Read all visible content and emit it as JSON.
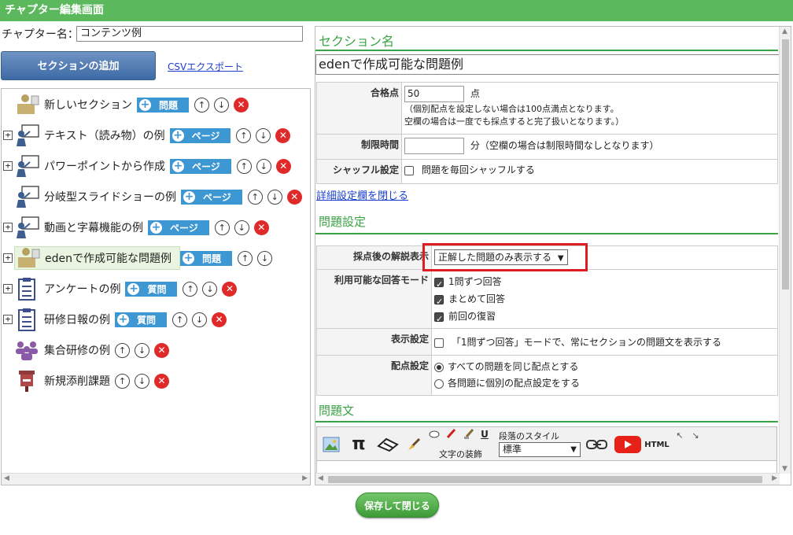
{
  "window": {
    "title": "チャプター編集画面"
  },
  "chapter": {
    "label": "チャプター名：",
    "value": "コンテンツ例"
  },
  "toolbar": {
    "add_section": "セクションの追加",
    "csv_export": "CSVエクスポート"
  },
  "tree": {
    "items": [
      {
        "label": "新しいセクション",
        "tag": "問題",
        "expandable": false,
        "icon": "teacher-podium-icon",
        "deletable": true
      },
      {
        "label": "テキスト（読み物）の例",
        "tag": "ページ",
        "expandable": true,
        "icon": "presenter-board-icon",
        "deletable": true
      },
      {
        "label": "パワーポイントから作成",
        "tag": "ページ",
        "expandable": true,
        "icon": "presenter-board-icon",
        "deletable": true
      },
      {
        "label": "分岐型スライドショーの例",
        "tag": "ページ",
        "expandable": false,
        "icon": "presenter-board-icon",
        "deletable": true
      },
      {
        "label": "動画と字幕機能の例",
        "tag": "ページ",
        "expandable": true,
        "icon": "presenter-board-icon",
        "deletable": true
      },
      {
        "label": "edenで作成可能な問題例",
        "tag": "問題",
        "expandable": true,
        "icon": "teacher-podium-icon",
        "deletable": false,
        "selected": true
      },
      {
        "label": "アンケートの例",
        "tag": "質問",
        "expandable": true,
        "icon": "clipboard-icon",
        "deletable": true
      },
      {
        "label": "研修日報の例",
        "tag": "質問",
        "expandable": true,
        "icon": "clipboard-icon",
        "deletable": true
      },
      {
        "label": "集合研修の例",
        "tag": "",
        "expandable": false,
        "icon": "group-people-icon",
        "deletable": true
      },
      {
        "label": "新規添削課題",
        "tag": "",
        "expandable": false,
        "icon": "postbox-icon",
        "deletable": true
      }
    ]
  },
  "section": {
    "heading": "セクション名",
    "name": "edenで作成可能な問題例",
    "pass_score": {
      "label": "合格点",
      "value": "50",
      "unit": "点",
      "note1": "（個別配点を設定しない場合は100点満点となります。",
      "note2": "空欄の場合は一度でも採点すると完了扱いとなります。）"
    },
    "time_limit": {
      "label": "制限時間",
      "value": "",
      "note": "分（空欄の場合は制限時間なしとなります）"
    },
    "shuffle": {
      "label": "シャッフル設定",
      "option": "問題を毎回シャッフルする",
      "checked": false
    },
    "toggle_link": "詳細設定欄を閉じる"
  },
  "question_settings": {
    "heading": "問題設定",
    "explanation": {
      "label": "採点後の解説表示",
      "selected": "正解した問題のみ表示する"
    },
    "modes": {
      "label": "利用可能な回答モード",
      "options": [
        "1問ずつ回答",
        "まとめて回答",
        "前回の復習"
      ]
    },
    "display": {
      "label": "表示設定",
      "option": "「1問ずつ回答」モードで、常にセクションの問題文を表示する",
      "checked": false
    },
    "points": {
      "label": "配点設定",
      "options": [
        "すべての問題を同じ配点とする",
        "各問題に個別の配点設定をする"
      ],
      "selected_index": 0
    }
  },
  "question_text": {
    "heading": "問題文",
    "decor_label": "文字の装飾",
    "para_style_label": "段落のスタイル",
    "para_style_value": "標準",
    "html_label": "HTML",
    "underline_label": "U",
    "pi_label": "π"
  },
  "footer": {
    "save_close": "保存して閉じる"
  },
  "colors": {
    "accent_green": "#5cb85c",
    "tag_blue": "#3d97d3",
    "delete_red": "#e02a2a",
    "highlight": "#e01b22"
  }
}
